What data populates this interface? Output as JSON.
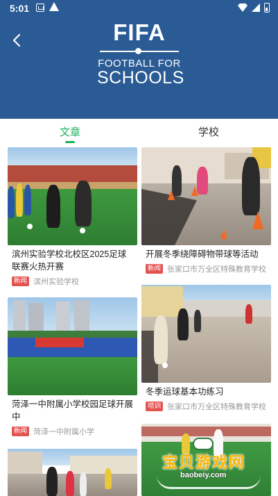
{
  "status_bar": {
    "time": "5:01"
  },
  "header": {
    "logo_fifa": "FIFA",
    "logo_line1": "FOOTBALL FOR",
    "logo_line2": "SCHOOLS"
  },
  "tabs": [
    {
      "label": "文章",
      "active": true
    },
    {
      "label": "学校",
      "active": false
    }
  ],
  "articles": [
    {
      "title": "滨州实验学校北校区2025足球联赛火热开赛",
      "tag": "新闻",
      "source": "滨州实验学校"
    },
    {
      "title": "开展冬季绕障碍物带球等活动",
      "tag": "新闻",
      "source": "张家口市万全区特殊教育学校"
    },
    {
      "title": "菏泽一中附属小学校园足球开展中",
      "tag": "新闻",
      "source": "菏泽一中附属小学"
    },
    {
      "title": "冬季运球基本功练习",
      "tag": "培训",
      "source": "张家口市万全区特殊教育学校"
    }
  ],
  "watermark": {
    "text": "宝贝游戏网",
    "url": "baobeiy.com"
  },
  "colors": {
    "header_bg": "#2a5b95",
    "accent_green": "#19b25b",
    "tag_red": "#e25350"
  }
}
